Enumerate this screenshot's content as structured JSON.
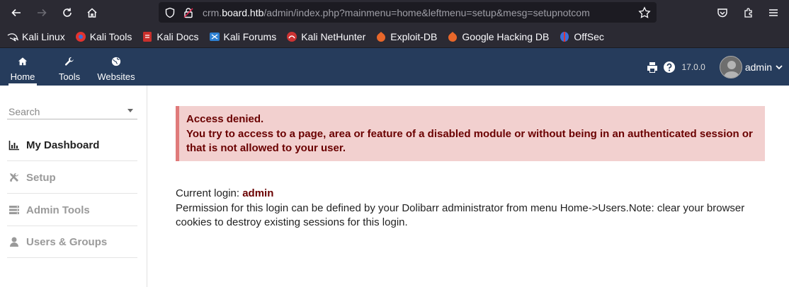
{
  "browser": {
    "url_prefix": "crm.",
    "url_host": "board.htb",
    "url_path": "/admin/index.php?mainmenu=home&leftmenu=setup&mesg=setupnotcom"
  },
  "bookmarks": [
    {
      "label": "Kali Linux",
      "icon": "kali-dragon-icon",
      "color": "#2a2a2a"
    },
    {
      "label": "Kali Tools",
      "icon": "kali-tools-icon",
      "color": "#e2332f"
    },
    {
      "label": "Kali Docs",
      "icon": "kali-docs-icon",
      "color": "#c9302c"
    },
    {
      "label": "Kali Forums",
      "icon": "kali-forums-icon",
      "color": "#2d7fd1"
    },
    {
      "label": "Kali NetHunter",
      "icon": "kali-nethunter-icon",
      "color": "#cc3333"
    },
    {
      "label": "Exploit-DB",
      "icon": "exploit-db-icon",
      "color": "#e8672a"
    },
    {
      "label": "Google Hacking DB",
      "icon": "ghdb-icon",
      "color": "#e8672a"
    },
    {
      "label": "OffSec",
      "icon": "offsec-icon",
      "color": "#3b6fd8"
    }
  ],
  "topmenu": {
    "items": [
      {
        "label": "Home",
        "icon": "home-icon"
      },
      {
        "label": "Tools",
        "icon": "wrench-icon"
      },
      {
        "label": "Websites",
        "icon": "globe-icon"
      }
    ],
    "version": "17.0.0",
    "user": "admin"
  },
  "sidebar": {
    "search_placeholder": "Search",
    "items": [
      {
        "label": "My Dashboard",
        "icon": "bar-chart-icon",
        "state": "active"
      },
      {
        "label": "Setup",
        "icon": "tools-icon",
        "state": "disabled"
      },
      {
        "label": "Admin Tools",
        "icon": "server-icon",
        "state": "disabled"
      },
      {
        "label": "Users & Groups",
        "icon": "user-icon",
        "state": "disabled"
      }
    ]
  },
  "alert": {
    "title": "Access denied.",
    "message": "You try to access to a page, area or feature of a disabled module or without being in an authenticated session or that is not allowed to your user."
  },
  "login": {
    "label": "Current login: ",
    "name": "admin",
    "note": "Permission for this login can be defined by your Dolibarr administrator from menu Home->Users.Note: clear your browser cookies to destroy existing sessions for this login."
  },
  "colors": {
    "header_bg": "#263c5c",
    "alert_bg": "#f2d0cf",
    "alert_text": "#6a0000"
  }
}
